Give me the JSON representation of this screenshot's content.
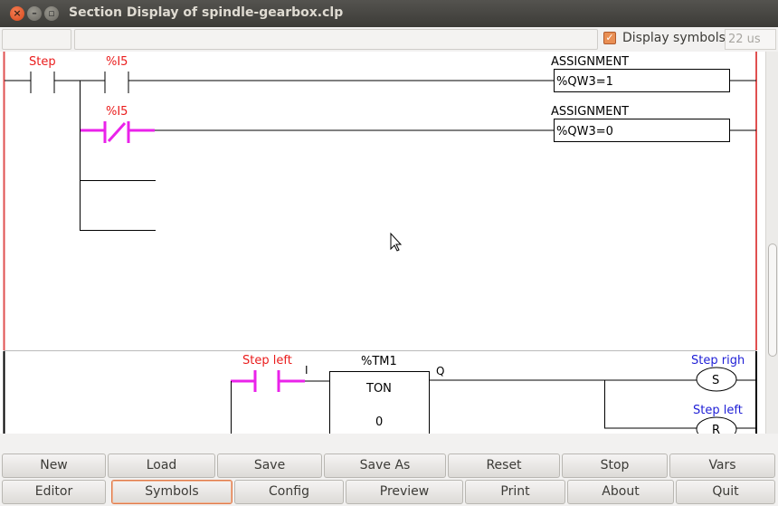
{
  "window": {
    "title": "Section Display of spindle-gearbox.clp",
    "close_glyph": "×",
    "min_glyph": "–",
    "max_glyph": "▫"
  },
  "toolbar": {
    "display_symbols_label": "Display symbols",
    "display_symbols_checked": true,
    "check_glyph": "✓",
    "cycle_time": "22 us"
  },
  "rung1": {
    "contact1_label": "Step",
    "contact2_label": "%I5",
    "assign1_title": "ASSIGNMENT",
    "assign1_expr": "%QW3=1",
    "contact3_label": "%I5",
    "assign2_title": "ASSIGNMENT",
    "assign2_expr": "%QW3=0"
  },
  "rung2": {
    "contact_label": "Step left",
    "timer_input": "I",
    "timer_output": "Q",
    "timer_name": "%TM1",
    "timer_type": "TON",
    "timer_preset": "0",
    "coil1_label": "Step righ",
    "coil1_type": "S",
    "coil2_label": "Step left",
    "coil2_type": "R"
  },
  "colors": {
    "active_contact": "#ea22ea",
    "section_border": "#e05050"
  },
  "buttons": {
    "row1": [
      "New",
      "Load",
      "Save",
      "Save As",
      "Reset",
      "Stop",
      "Vars"
    ],
    "row2": [
      "Editor",
      "Symbols",
      "Config",
      "Preview",
      "Print",
      "About",
      "Quit"
    ],
    "active": "Symbols"
  }
}
